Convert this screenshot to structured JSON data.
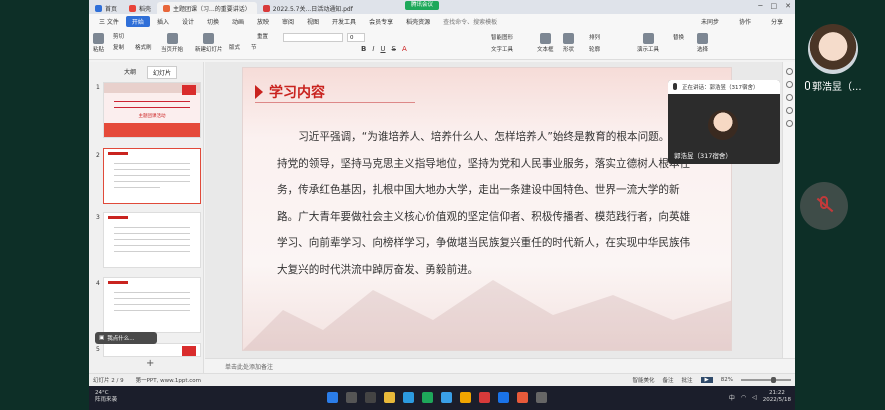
{
  "tabs": [
    {
      "label": "首页"
    },
    {
      "label": "稻壳"
    },
    {
      "label": "主题团课（习...的重要讲话）"
    },
    {
      "label": "2022.5.7关...日活动通知.pdf"
    }
  ],
  "sharing_badge": "腾讯会议",
  "menu": {
    "file": "三 文件",
    "items": [
      "开始",
      "插入",
      "设计",
      "切换",
      "动画",
      "放映",
      "审阅",
      "视图",
      "开发工具",
      "会员专享",
      "稻壳资源"
    ],
    "search": "查找命令、搜索模板",
    "cooperate": "未同步",
    "collab": "协作",
    "share": "分享"
  },
  "toolbar": {
    "buttons": [
      "粘贴",
      "剪切",
      "复制",
      "格式刷",
      "当页开始",
      "新建幻灯片",
      "版式",
      "节",
      "重置"
    ],
    "font_size": "0",
    "right_buttons": [
      "文本框",
      "形状",
      "排列",
      "轮廓",
      "演示工具",
      "替换",
      "选择"
    ],
    "tools": [
      "智能图形",
      "文字工具"
    ]
  },
  "left_panel": {
    "tab_outline": "大纲",
    "tab_slides": "幻灯片",
    "slide_numbers": [
      "1",
      "2",
      "3",
      "4",
      "5"
    ],
    "thumb1_title": "主题团课活动",
    "comment_label": "我点什么..."
  },
  "slide": {
    "title": "学习内容",
    "paragraph": "习近平强调，“为谁培养人、培养什么人、怎样培养人”始终是教育的根本问题。要坚持党的领导，坚持马克思主义指导地位，坚持为党和人民事业服务，落实立德树人根本任务，传承红色基因，扎根中国大地办大学，走出一条建设中国特色、世界一流大学的新路。广大青年要做社会主义核心价值观的坚定信仰者、积极传播者、模范践行者，向英雄学习、向前辈学习、向榜样学习，争做堪当民族复兴重任的时代新人，在实现中华民族伟大复兴的时代洪流中踔厉奋发、勇毅前进。"
  },
  "notes_placeholder": "单击此处添加备注",
  "status": {
    "slide": "幻灯片 2 / 9",
    "theme": "第一PPT, www.1ppt.com",
    "smart_beautify": "智能美化",
    "notes": "备注",
    "comments": "批注",
    "zoom": "82%"
  },
  "meeting": {
    "speaking": "正在讲话：郭浩昱（317宿舍）",
    "tile_name": "郭浩昱（317宿舍）",
    "side_name": "郭浩昱（..."
  },
  "taskbar": {
    "temp": "24°C",
    "weather": "阵雨来袭",
    "lang": "中",
    "time": "21:22",
    "date": "2022/5/18"
  }
}
